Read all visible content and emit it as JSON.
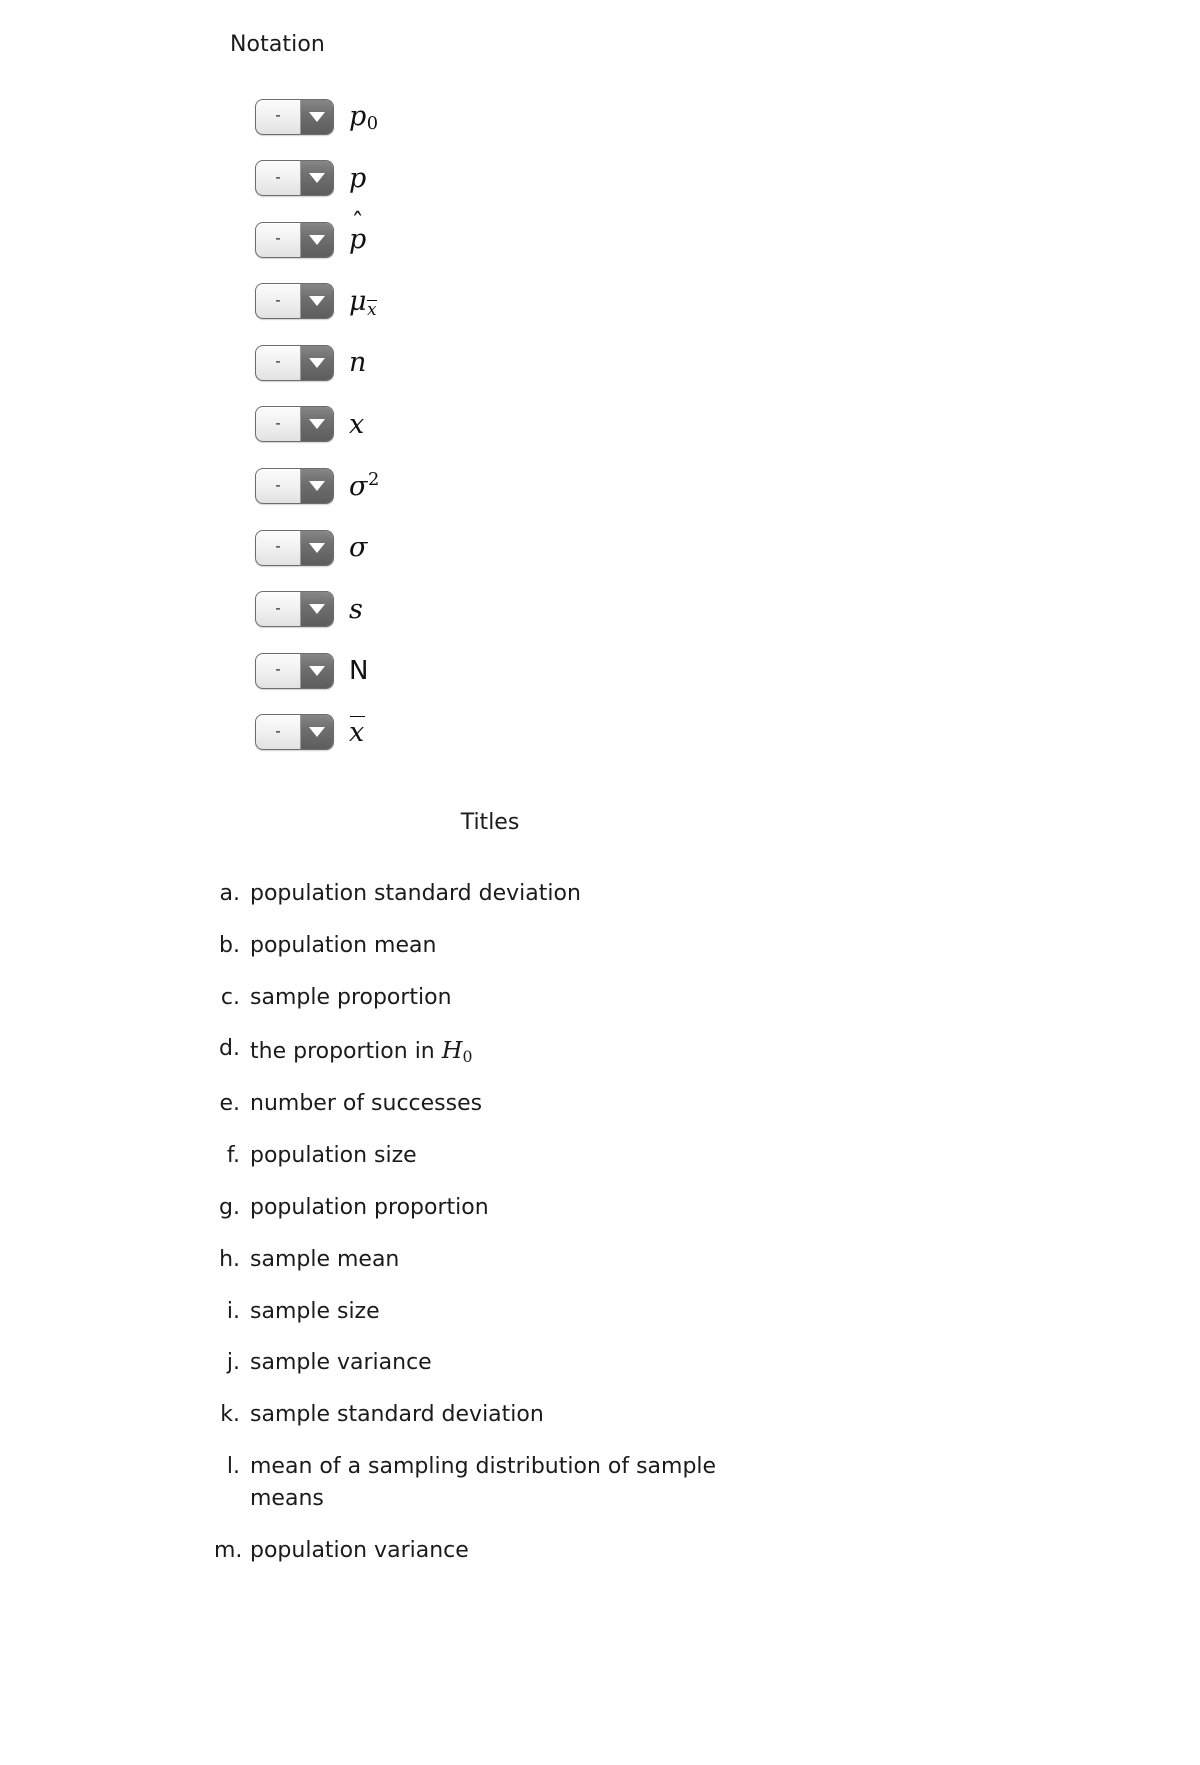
{
  "page": {
    "background_color": "#ffffff",
    "text_color": "#1b1b1b"
  },
  "notation": {
    "heading": "Notation",
    "dropdown_placeholder": "-",
    "dropdown_arrow_icon": "chevron-down-icon",
    "rows": [
      {
        "index": 1,
        "selected_value": "-",
        "symbol": "p0",
        "symbol_label": "p subscript 0"
      },
      {
        "index": 2,
        "selected_value": "-",
        "symbol": "p",
        "symbol_label": "p"
      },
      {
        "index": 3,
        "selected_value": "-",
        "symbol": "p-hat",
        "symbol_label": "p hat"
      },
      {
        "index": 4,
        "selected_value": "-",
        "symbol": "mu_xbar",
        "symbol_label": "mu subscript x bar"
      },
      {
        "index": 5,
        "selected_value": "-",
        "symbol": "n",
        "symbol_label": "n"
      },
      {
        "index": 6,
        "selected_value": "-",
        "symbol": "x",
        "symbol_label": "x"
      },
      {
        "index": 7,
        "selected_value": "-",
        "symbol": "sigma^2",
        "symbol_label": "sigma squared"
      },
      {
        "index": 8,
        "selected_value": "-",
        "symbol": "sigma",
        "symbol_label": "sigma"
      },
      {
        "index": 9,
        "selected_value": "-",
        "symbol": "s",
        "symbol_label": "s"
      },
      {
        "index": 10,
        "selected_value": "-",
        "symbol": "N",
        "symbol_label": "N"
      },
      {
        "index": 11,
        "selected_value": "-",
        "symbol": "xbar",
        "symbol_label": "x bar"
      }
    ]
  },
  "titles": {
    "heading": "Titles",
    "items": [
      {
        "marker": "a.",
        "text": "population standard deviation"
      },
      {
        "marker": "b.",
        "text": "population mean"
      },
      {
        "marker": "c.",
        "text": "sample proportion"
      },
      {
        "marker": "d.",
        "text": "the proportion in ",
        "math": "H0",
        "math_label": "H subscript 0"
      },
      {
        "marker": "e.",
        "text": "number of successes"
      },
      {
        "marker": "f.",
        "text": "population size"
      },
      {
        "marker": "g.",
        "text": "population proportion"
      },
      {
        "marker": "h.",
        "text": "sample mean"
      },
      {
        "marker": "i.",
        "text": "sample size"
      },
      {
        "marker": "j.",
        "text": "sample variance"
      },
      {
        "marker": "k.",
        "text": "sample standard deviation"
      },
      {
        "marker": "l.",
        "text": "mean of a sampling distribution of sample means"
      },
      {
        "marker": "m.",
        "text": "population variance"
      }
    ]
  }
}
